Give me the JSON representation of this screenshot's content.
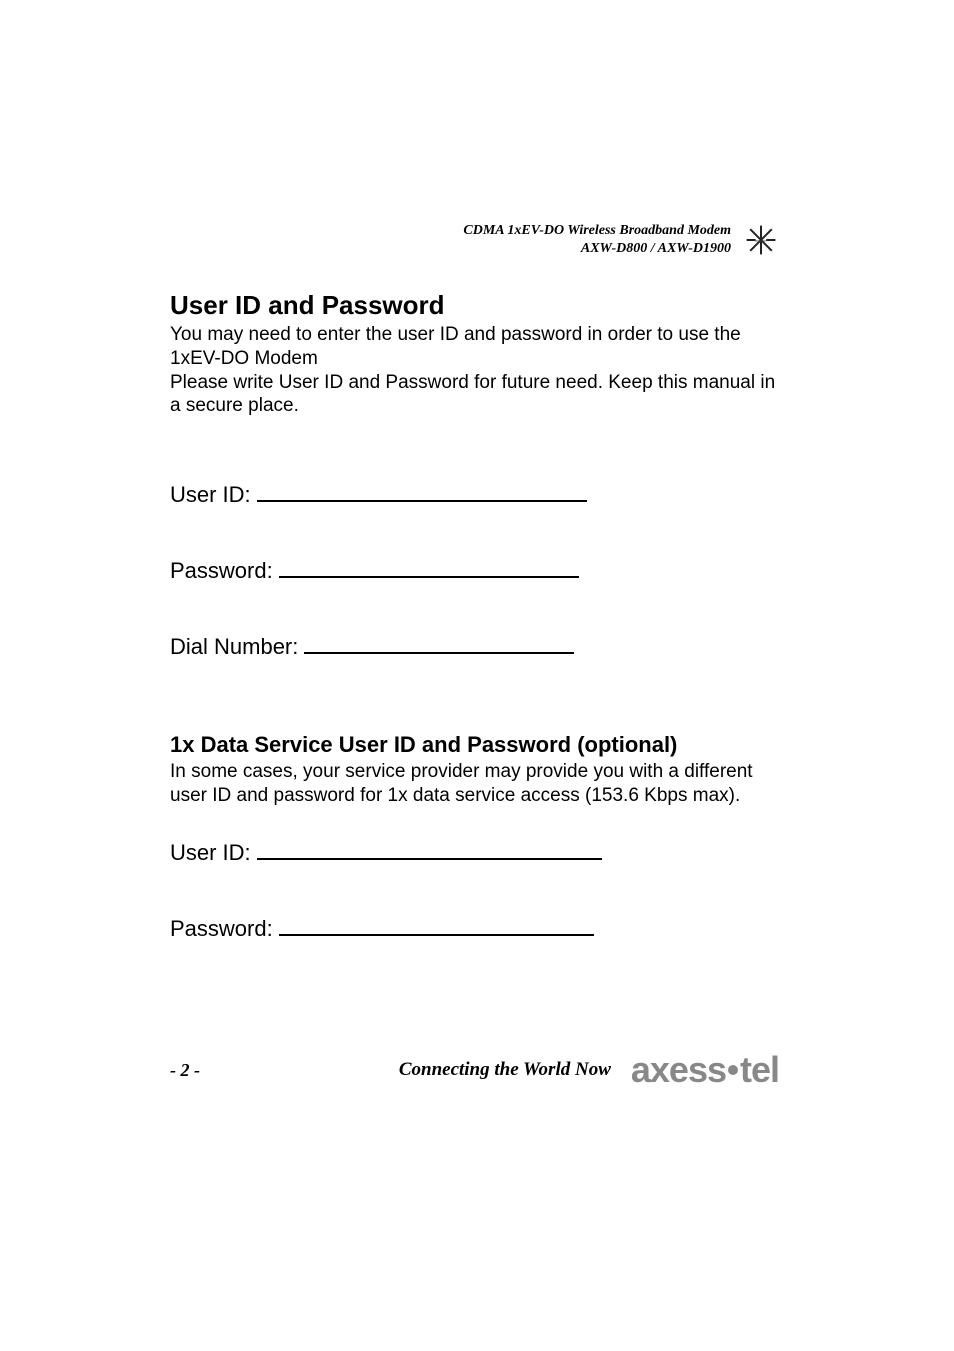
{
  "header": {
    "line1": "CDMA 1xEV-DO Wireless Broadband Modem",
    "line2": "AXW-D800 / AXW-D1900"
  },
  "section1": {
    "title": "User ID and Password",
    "para1": "You may need to enter the user ID and password in order to use the 1xEV-DO Modem",
    "para2": "Please write User ID and Password for future need.  Keep this manual in a secure place.",
    "fields": {
      "userid_label": "User ID:",
      "password_label": "Password:",
      "dial_label": "Dial Number:"
    }
  },
  "section2": {
    "title": "1x Data Service User ID and Password (optional)",
    "para1": "In some cases, your service provider may provide you with a different user ID and password for 1x data service access (153.6 Kbps max).",
    "fields": {
      "userid_label": "User ID:",
      "password_label": "Password:"
    }
  },
  "footer": {
    "page_number": "- 2 -",
    "tagline": "Connecting the World Now",
    "brand_part1": "axess",
    "brand_part2": "tel"
  }
}
